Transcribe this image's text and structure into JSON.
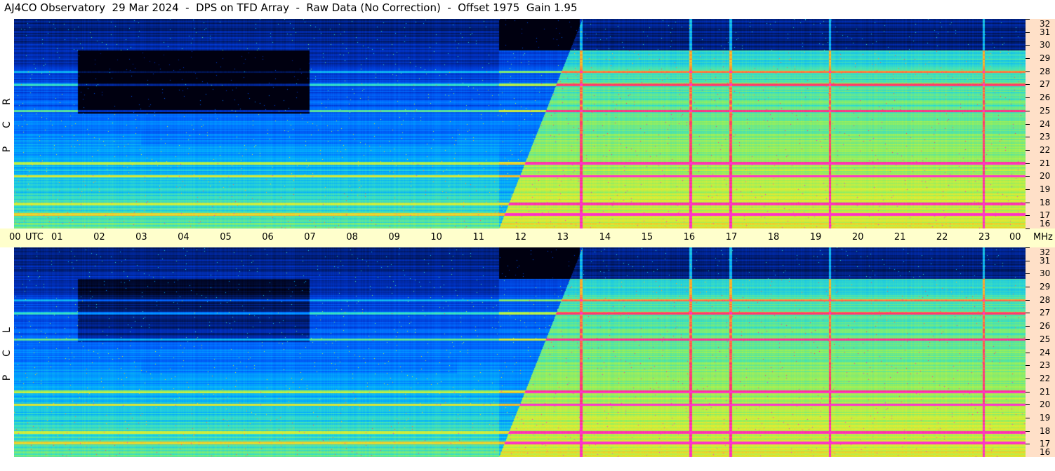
{
  "title": "AJ4CO Observatory  29 Mar 2024  -  DPS on TFD Array  -  Raw Data (No Correction)  -  Offset 1975  Gain 1.95",
  "panels": [
    {
      "id": "rcp",
      "letters": [
        "R",
        "C",
        "P"
      ]
    },
    {
      "id": "lcp",
      "letters": [
        "L",
        "C",
        "P"
      ]
    }
  ],
  "chart_data": {
    "type": "heatmap",
    "title": "AJ4CO Observatory  29 Mar 2024  -  DPS on TFD Array  -  Raw Data (No Correction)  -  Offset 1975  Gain 1.95",
    "x_axis": {
      "unit_label": "UTC",
      "range": [
        0,
        24
      ],
      "tick_labels": [
        "00",
        "01",
        "02",
        "03",
        "04",
        "05",
        "06",
        "07",
        "08",
        "09",
        "10",
        "11",
        "12",
        "13",
        "14",
        "15",
        "16",
        "17",
        "18",
        "19",
        "20",
        "21",
        "22",
        "23",
        "00"
      ]
    },
    "y_axis": {
      "unit_label": "MHz",
      "range": [
        16,
        32
      ],
      "tick_labels": [
        "32",
        "31",
        "30",
        "29",
        "28",
        "27",
        "26",
        "25",
        "24",
        "23",
        "22",
        "21",
        "20",
        "19",
        "18",
        "17",
        "16"
      ]
    },
    "series": [
      {
        "name": "RCP",
        "label_letters": [
          "R",
          "C",
          "P"
        ]
      },
      {
        "name": "LCP",
        "label_letters": [
          "L",
          "C",
          "P"
        ]
      }
    ],
    "colormap": [
      "#000010",
      "#001a66",
      "#0033cc",
      "#0066ff",
      "#00aaff",
      "#33ddcc",
      "#88ee66",
      "#ddee33",
      "#ffaa22",
      "#ff3366",
      "#ff33cc"
    ],
    "noted_features": {
      "interference_bands_MHz": [
        17.1,
        17.9,
        20,
        21,
        25,
        27,
        28
      ],
      "vertical_lines_UTC": [
        13.45,
        16.05,
        17.0,
        19.35,
        23.0
      ],
      "day_transition_UTC": 11.5
    },
    "grid": false
  }
}
